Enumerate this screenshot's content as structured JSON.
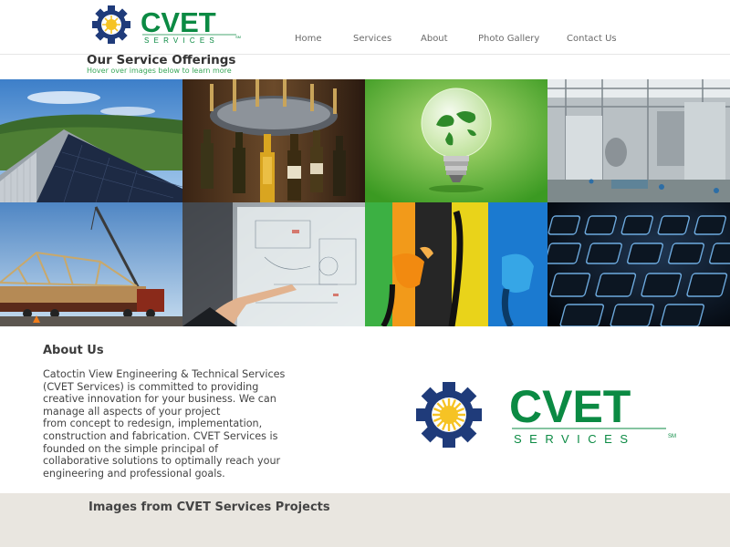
{
  "brand": {
    "name": "CVET",
    "tagline": "SERVICES",
    "mark": "SM",
    "colors": {
      "green": "#0b8a43",
      "navy": "#1f3b7a",
      "sun": "#f6c324"
    }
  },
  "nav": {
    "items": [
      {
        "label": "Home"
      },
      {
        "label": "Services"
      },
      {
        "label": "About"
      },
      {
        "label": "Photo Gallery"
      },
      {
        "label": "Contact Us"
      }
    ]
  },
  "offerings": {
    "title": "Our Service Offerings",
    "subtitle": "Hover over images below to learn more",
    "tiles": [
      {
        "icon": "solar-roof-photo"
      },
      {
        "icon": "bottling-line-photo"
      },
      {
        "icon": "lightbulb-globe-photo"
      },
      {
        "icon": "industrial-plant-photo"
      },
      {
        "icon": "truss-crane-photo"
      },
      {
        "icon": "engineering-drawing-photo"
      },
      {
        "icon": "fuel-pumps-photo"
      },
      {
        "icon": "keyboard-photo"
      }
    ]
  },
  "about": {
    "title": "About Us",
    "text": "Catoctin View Engineering & Technical Services\n(CVET Services) is committed to providing\ncreative innovation for your business.  We can\nmanage all aspects of your project\nfrom concept to redesign, implementation,\nconstruction and fabrication.  CVET Services is\nfounded on the simple principal of\ncollaborative solutions to optimally reach your\nengineering and professional goals."
  },
  "projects": {
    "title": "Images from CVET Services Projects"
  }
}
